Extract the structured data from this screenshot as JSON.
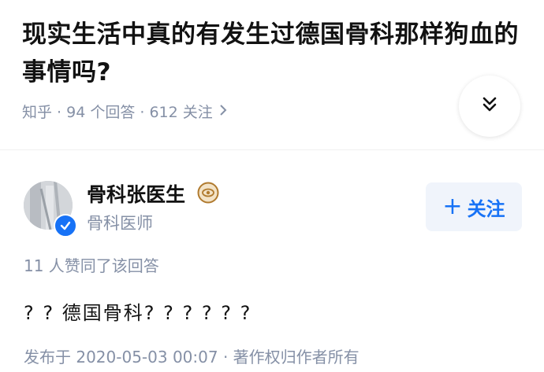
{
  "question": {
    "title": "现实生活中真的有发生过德国骨科那样狗血的事情吗?",
    "meta": "知乎 · 94 个回答 · 612 关注",
    "meta_chevron_icon": "chevron-right-icon",
    "expand_icon": "double-chevron-down-icon"
  },
  "answer": {
    "author": {
      "name": "骨科张医生",
      "title": "骨科医师",
      "verified_icon": "verified-check-icon",
      "badge_icon": "eye-badge-icon"
    },
    "follow_button": {
      "plus": "+",
      "label": "关注"
    },
    "votes": "11 人赞同了该回答",
    "content": "? ? 德国骨科? ? ? ? ? ?",
    "published": "发布于 2020-05-03 00:07 · 著作权归作者所有"
  },
  "colors": {
    "accent": "#1772f6",
    "muted": "#8590a6",
    "follow_bg": "#f0f4fb",
    "badge": "#b07a2e"
  }
}
